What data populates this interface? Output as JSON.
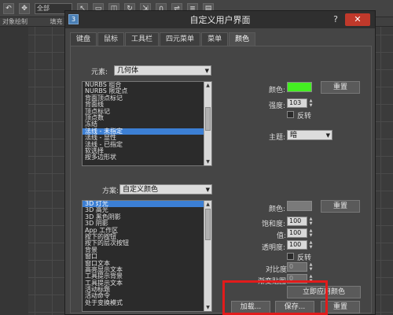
{
  "background": {
    "toolbar_select": "全部",
    "secondbar": [
      "对象绘制",
      "填充"
    ]
  },
  "dialog": {
    "title": "自定义用户界面",
    "help": "?",
    "close": "✕",
    "tabs": [
      "键盘",
      "鼠标",
      "工具栏",
      "四元菜单",
      "菜单",
      "颜色"
    ],
    "active_tab": "颜色"
  },
  "element": {
    "label": "元素:",
    "value": "几何体",
    "items": [
      "NURBS 组合",
      "NURBS 限定点",
      "背面顶点标记",
      "背面线",
      "顶点标记",
      "顶点数",
      "冻结",
      "法线 - 未指定",
      "法线 - 显性",
      "法线 - 已指定",
      "软选择",
      "按多边形状"
    ],
    "selected_index": 7
  },
  "color_panel1": {
    "color_label": "颜色:",
    "color_value": "#44ee22",
    "reset": "重置",
    "intensity_label": "强度:",
    "intensity_value": "103",
    "invert_label": "反转",
    "theme_label": "主题:",
    "theme_value": "暗"
  },
  "scheme": {
    "label": "方案:",
    "value": "自定义颜色",
    "items": [
      "3D 灯光",
      "3D 高光",
      "3D 黑色阴影",
      "3D 阴影",
      "App 工作区",
      "按下的按钮",
      "按下的层次按钮",
      "背景",
      "窗口",
      "窗口文本",
      "高亮显示文本",
      "工具提示背景",
      "工具提示文本",
      "活动标题",
      "活动命令",
      "处于变换模式"
    ],
    "selected_index": 0
  },
  "color_panel2": {
    "color_label": "颜色:",
    "color_value": "#7a7a7a",
    "reset": "重置",
    "saturation_label": "饱和度:",
    "saturation_value": "100",
    "value_label": "值:",
    "value_value": "100",
    "transparency_label": "透明度:",
    "transparency_value": "100",
    "invert_label": "反转",
    "contrast_label": "对比度:",
    "contrast_value": "0",
    "fade_label": "渐变贴图:",
    "fade_value": "0",
    "apply_now": "立即应用颜色"
  },
  "footer": {
    "load": "加载...",
    "save": "保存...",
    "reset": "重置"
  },
  "colors": {
    "highlight": "#e21b1b",
    "selection": "#3c7fd4"
  }
}
